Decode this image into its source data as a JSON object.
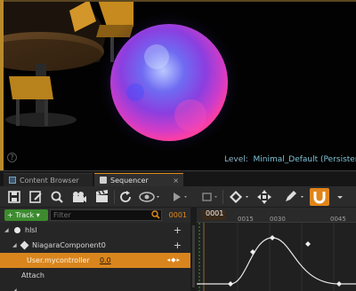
{
  "viewport": {
    "level_prefix": "Level:",
    "level_name": "Minimal_Default (Persistent)",
    "help_icon": "help-icon"
  },
  "tabs": [
    {
      "label": "Content Browser",
      "icon": "content-browser-icon",
      "active": false
    },
    {
      "label": "Sequencer",
      "icon": "sequencer-icon",
      "active": true,
      "close": "×"
    }
  ],
  "toolbar": {
    "icons": [
      "save-icon",
      "save-as-icon",
      "find-asset-icon",
      "camera-icon",
      "render-movie-icon",
      "refresh-icon",
      "eye-icon",
      "play-icon",
      "selection-icon",
      "key-icon",
      "transform-icon",
      "pencil-icon",
      "snap-magnet-icon"
    ],
    "accent": "#e0851a"
  },
  "outliner": {
    "track_button": "Track",
    "filter_placeholder": "Filter",
    "current_frame": "0001",
    "rows": [
      {
        "label": "hlsl",
        "expanded": true
      },
      {
        "label": "NiagaraComponent0",
        "expanded": true
      },
      {
        "label": "User.mycontroller",
        "value": "0.0",
        "selected": true
      },
      {
        "label": "Attach"
      }
    ]
  },
  "timeline": {
    "playhead_label": "0001",
    "ticks": [
      "0015",
      "0030",
      "0045"
    ]
  },
  "colors": {
    "selection": "#d9851e",
    "track_button": "#3c8c2e",
    "level_text": "#7ec3d6"
  }
}
